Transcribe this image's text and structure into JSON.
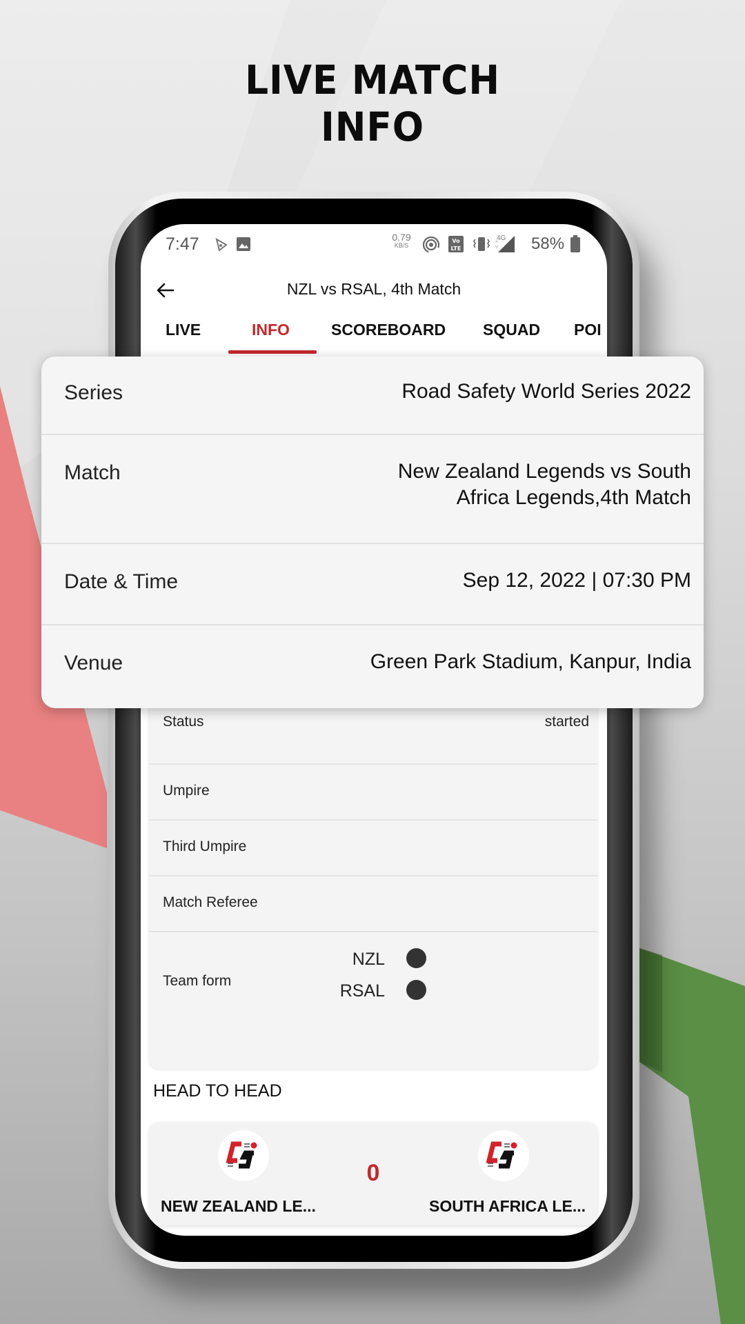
{
  "promo": {
    "headline_line1": "LIVE MATCH",
    "headline_line2": "INFO"
  },
  "colors": {
    "accent": "#c3282c",
    "red_shape": "#e98182",
    "green_shape": "#5a8f45",
    "card_bg": "#f5f5f5"
  },
  "statusbar": {
    "time": "7:47",
    "left_icons": [
      "cast-notification-icon",
      "gallery-notification-icon"
    ],
    "net_speed": "0.79",
    "net_speed_unit": "KB/S",
    "right_icons": [
      "hotspot-icon",
      "volte-icon",
      "vibrate-icon",
      "4g-signal-icon"
    ],
    "network_type": "4G",
    "battery": "58%"
  },
  "appbar": {
    "title": "NZL vs RSAL, 4th Match",
    "back_icon": "arrow-left-icon"
  },
  "tabs": [
    {
      "label": "LIVE",
      "active": false
    },
    {
      "label": "INFO",
      "active": true
    },
    {
      "label": "SCOREBOARD",
      "active": false
    },
    {
      "label": "SQUAD",
      "active": false
    },
    {
      "label": "POI",
      "active": false
    }
  ],
  "info_overlay": {
    "rows": [
      {
        "label": "Series",
        "value": "Road Safety World Series 2022"
      },
      {
        "label": "Match",
        "value_line1": "New Zealand Legends vs South",
        "value_line2": "Africa Legends,4th Match"
      },
      {
        "label": "Date & Time",
        "value": "Sep 12, 2022 | 07:30 PM"
      },
      {
        "label": "Venue",
        "value": "Green Park Stadium, Kanpur, India"
      }
    ]
  },
  "info_list": {
    "rows": [
      {
        "label": "Status",
        "value": "started"
      },
      {
        "label": "Umpire",
        "value": ""
      },
      {
        "label": "Third Umpire",
        "value": ""
      },
      {
        "label": "Match Referee",
        "value": ""
      }
    ],
    "team_form": {
      "label": "Team form",
      "teams": [
        {
          "code": "NZL"
        },
        {
          "code": "RSAL"
        }
      ]
    }
  },
  "head_to_head": {
    "title": "HEAD TO HEAD",
    "score": "0",
    "team1": {
      "name": "NEW ZEALAND LE...",
      "logo_text": "CS"
    },
    "team2": {
      "name": "SOUTH AFRICA LE...",
      "logo_text": "CS"
    }
  }
}
